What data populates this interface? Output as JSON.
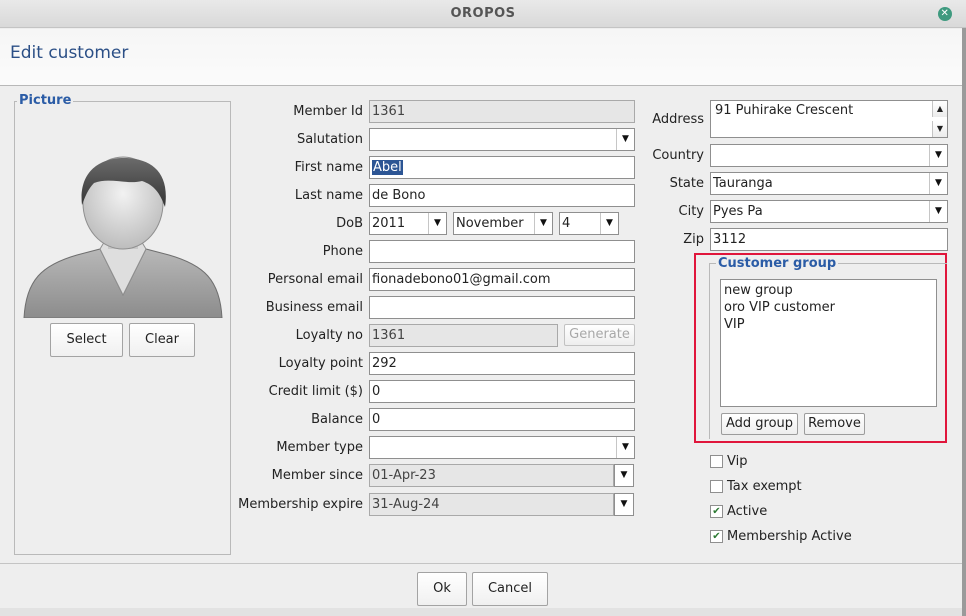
{
  "window": {
    "title": "OROPOS",
    "close_glyph": "✕"
  },
  "header": {
    "title": "Edit customer"
  },
  "picture": {
    "legend": "Picture",
    "select_label": "Select",
    "clear_label": "Clear"
  },
  "form": {
    "member_id": {
      "label": "Member Id",
      "value": "1361"
    },
    "salutation": {
      "label": "Salutation",
      "value": ""
    },
    "first_name": {
      "label": "First name",
      "value": "Abel"
    },
    "last_name": {
      "label": "Last name",
      "value": "de Bono"
    },
    "dob": {
      "label": "DoB",
      "year": "2011",
      "month": "November",
      "day": "4"
    },
    "phone": {
      "label": "Phone",
      "value": ""
    },
    "personal_email": {
      "label": "Personal email",
      "value": "fionadebono01@gmail.com"
    },
    "business_email": {
      "label": "Business email",
      "value": ""
    },
    "loyalty_no": {
      "label": "Loyalty no",
      "value": "1361",
      "generate_label": "Generate"
    },
    "loyalty_point": {
      "label": "Loyalty point",
      "value": "292"
    },
    "credit_limit": {
      "label": "Credit limit ($)",
      "value": "0"
    },
    "balance": {
      "label": "Balance",
      "value": "0"
    },
    "member_type": {
      "label": "Member type",
      "value": ""
    },
    "member_since": {
      "label": "Member since",
      "value": "01-Apr-23"
    },
    "membership_expire": {
      "label": "Membership expire",
      "value": "31-Aug-24"
    }
  },
  "address": {
    "address": {
      "label": "Address",
      "value": "91 Puhirake Crescent"
    },
    "country": {
      "label": "Country",
      "value": ""
    },
    "state": {
      "label": "State",
      "value": "Tauranga"
    },
    "city": {
      "label": "City",
      "value": "Pyes Pa"
    },
    "zip": {
      "label": "Zip",
      "value": "3112"
    }
  },
  "customer_group": {
    "legend": "Customer group",
    "items": [
      "new group",
      "oro VIP customer",
      "VIP"
    ],
    "add_label": "Add group",
    "remove_label": "Remove",
    "highlight_color": "#e0163b"
  },
  "checks": [
    {
      "label": "Vip",
      "checked": false
    },
    {
      "label": "Tax exempt",
      "checked": false
    },
    {
      "label": "Active",
      "checked": true
    },
    {
      "label": "Membership Active",
      "checked": true
    }
  ],
  "footer": {
    "ok_label": "Ok",
    "cancel_label": "Cancel"
  },
  "icons": {
    "dropdown": "chevron-down-icon",
    "check": "check-icon",
    "avatar": "user-avatar-icon"
  }
}
